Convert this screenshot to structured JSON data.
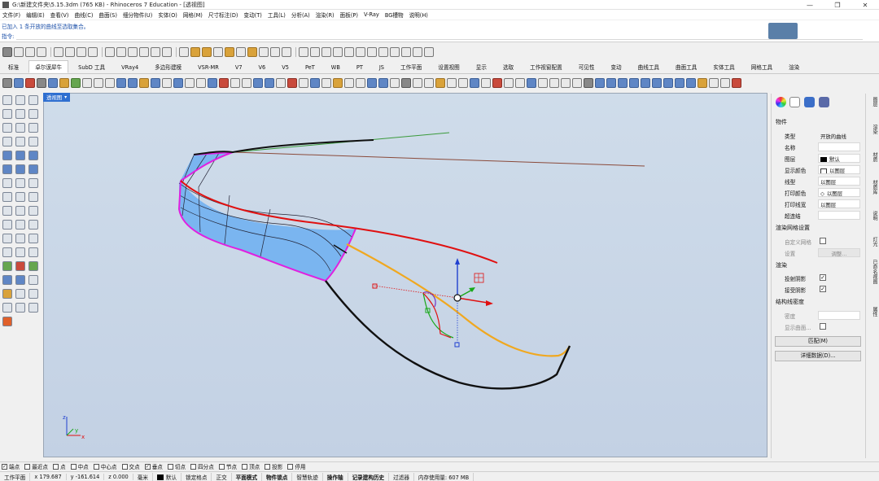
{
  "window": {
    "title": "G:\\新建文件夹\\5.15.3dm (765 KB) - Rhinoceros 7 Education - [透视图]"
  },
  "menu": [
    "文件(F)",
    "编辑(E)",
    "查看(V)",
    "曲线(C)",
    "曲面(S)",
    "细分物件(U)",
    "实体(O)",
    "网格(M)",
    "尺寸标注(D)",
    "变动(T)",
    "工具(L)",
    "分析(A)",
    "渲染(R)",
    "面板(P)",
    "V-Ray",
    "BG槽物",
    "说明(H)"
  ],
  "command": {
    "history": "已加入 1 条开放的曲线至选取集合。",
    "prompt": "指令:"
  },
  "tabs": [
    "标准",
    "卓尔谟犀牛",
    "SubD 工具",
    "VRay4",
    "多边形建模",
    "VSR-MR",
    "V7",
    "V6",
    "V5",
    "PeT",
    "WB",
    "PT",
    "JS",
    "工作平面",
    "设置视图",
    "显示",
    "选取",
    "工作视窗配置",
    "可见性",
    "变动",
    "曲线工具",
    "曲面工具",
    "实体工具",
    "网格工具",
    "渲染"
  ],
  "active_tab_index": 1,
  "viewport": {
    "label": "透视图"
  },
  "properties": {
    "section_object": "物件",
    "rows": [
      {
        "label": "类型",
        "value": "开放的曲线"
      },
      {
        "label": "名称",
        "value": ""
      },
      {
        "label": "图层",
        "value": "默认"
      },
      {
        "label": "显示颜色",
        "value": "以图层"
      },
      {
        "label": "线型",
        "value": "以图层"
      },
      {
        "label": "打印颜色",
        "value": "以图层"
      },
      {
        "label": "打印线宽",
        "value": "以图层"
      },
      {
        "label": "超连结",
        "value": ""
      }
    ],
    "section_render_mesh": "渲染网格设置",
    "custom_mesh_label": "自定义网格",
    "settings_label": "设置",
    "adjust_button": "调整...",
    "section_render": "渲染",
    "cast_shadow_label": "投射阴影",
    "receive_shadow_label": "接受阴影",
    "section_wire": "结构线密度",
    "density_label": "密度",
    "show_surface_label": "显示曲面...",
    "match_button": "匹配(M)",
    "details_button": "详细数据(D)..."
  },
  "side_tabs": [
    "图层",
    "渲染",
    "材质",
    "材质库",
    "说明",
    "灯光",
    "已命名视图",
    "属性"
  ],
  "osnap": [
    {
      "label": "端点",
      "checked": true
    },
    {
      "label": "最近点",
      "checked": false
    },
    {
      "label": "点",
      "checked": false
    },
    {
      "label": "中点",
      "checked": false
    },
    {
      "label": "中心点",
      "checked": false
    },
    {
      "label": "交点",
      "checked": false
    },
    {
      "label": "垂点",
      "checked": true
    },
    {
      "label": "切点",
      "checked": false
    },
    {
      "label": "四分点",
      "checked": false
    },
    {
      "label": "节点",
      "checked": false
    },
    {
      "label": "顶点",
      "checked": false
    },
    {
      "label": "投影",
      "checked": false
    },
    {
      "label": "停用",
      "checked": false
    }
  ],
  "status": {
    "cplane": "工作平面",
    "x": "x 179.687",
    "y": "y -161.614",
    "z": "z 0.000",
    "units": "毫米",
    "layer": "默认",
    "lock_grid": "锁定格点",
    "ortho": "正交",
    "planar": "平面模式",
    "osnap": "物件锁点",
    "smarttrack": "智慧轨迹",
    "gumball": "操作轴",
    "history": "记录建构历史",
    "filter": "过滤器",
    "memory": "内存使用量: 607 MB"
  },
  "colors": {
    "viewport_top": "#cfdcea",
    "viewport_bottom": "#c3d1e4",
    "surface_fill": "#79b6f2",
    "edge_magenta": "#e020e0",
    "curve_red": "#e01010",
    "curve_orange": "#f0a820",
    "curve_black": "#101010"
  }
}
